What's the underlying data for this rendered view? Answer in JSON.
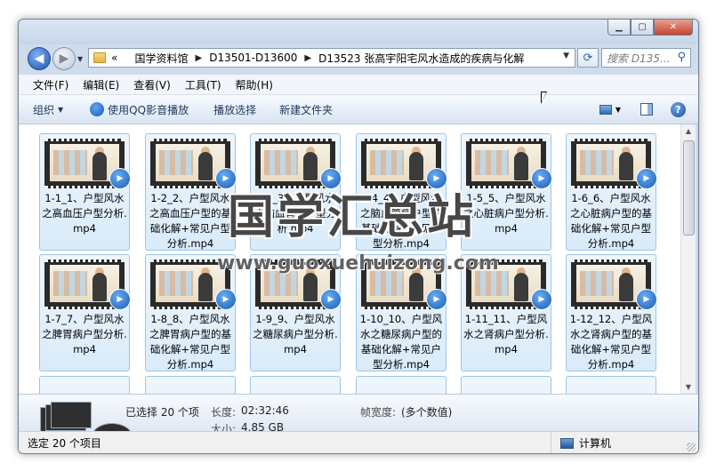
{
  "window": {
    "caption": {
      "minimize": "▁",
      "maximize": "▢",
      "close": "✕"
    }
  },
  "nav": {
    "back_icon": "back-arrow-icon",
    "forward_icon": "forward-arrow-icon",
    "address": {
      "lead": "«",
      "crumbs": [
        "国学资料馆",
        "D13501-D13600",
        "D13523 张高宇阳宅风水造成的疾病与化解"
      ]
    },
    "search": {
      "placeholder": "搜索 D135..."
    }
  },
  "menu": [
    "文件(F)",
    "编辑(E)",
    "查看(V)",
    "工具(T)",
    "帮助(H)"
  ],
  "toolbar": {
    "organize": "组织",
    "play_qq": "使用QQ影音播放",
    "play_selection": "播放选择",
    "new_folder": "新建文件夹"
  },
  "files": [
    "1-1_1、户型风水之高血压户型分析.mp4",
    "1-2_2、户型风水之高血压户型的基础化解+常见户型分析.mp4",
    "1-3_3、户型风水之脑血管病户型分析.mp4",
    "1-4_4、户型风水之脑血管病户型的基础化解+常见户型分析.mp4",
    "1-5_5、户型风水之心脏病户型分析.mp4",
    "1-6_6、户型风水之心脏病户型的基础化解+常见户型分析.mp4",
    "1-7_7、户型风水之脾胃病户型分析.mp4",
    "1-8_8、户型风水之脾胃病户型的基础化解+常见户型分析.mp4",
    "1-9_9、户型风水之糖尿病户型分析.mp4",
    "1-10_10、户型风水之糖尿病户型的基础化解+常见户型分析.mp4",
    "1-11_11、户型风水之肾病户型分析.mp4",
    "1-12_12、户型风水之肾病户型的基础化解+常见户型分析.mp4"
  ],
  "details": {
    "selected": "已选择 20 个项",
    "length_label": "长度:",
    "length_value": "02:32:46",
    "size_label": "大小:",
    "size_value": "4.85 GB",
    "framewidth_label": "帧宽度:",
    "framewidth_value": "(多个数值)"
  },
  "status": {
    "left": "选定 20 个项目",
    "right": "计算机"
  },
  "watermark": {
    "text": "国学汇总站",
    "url": "www.guoxuehuizong.com"
  }
}
